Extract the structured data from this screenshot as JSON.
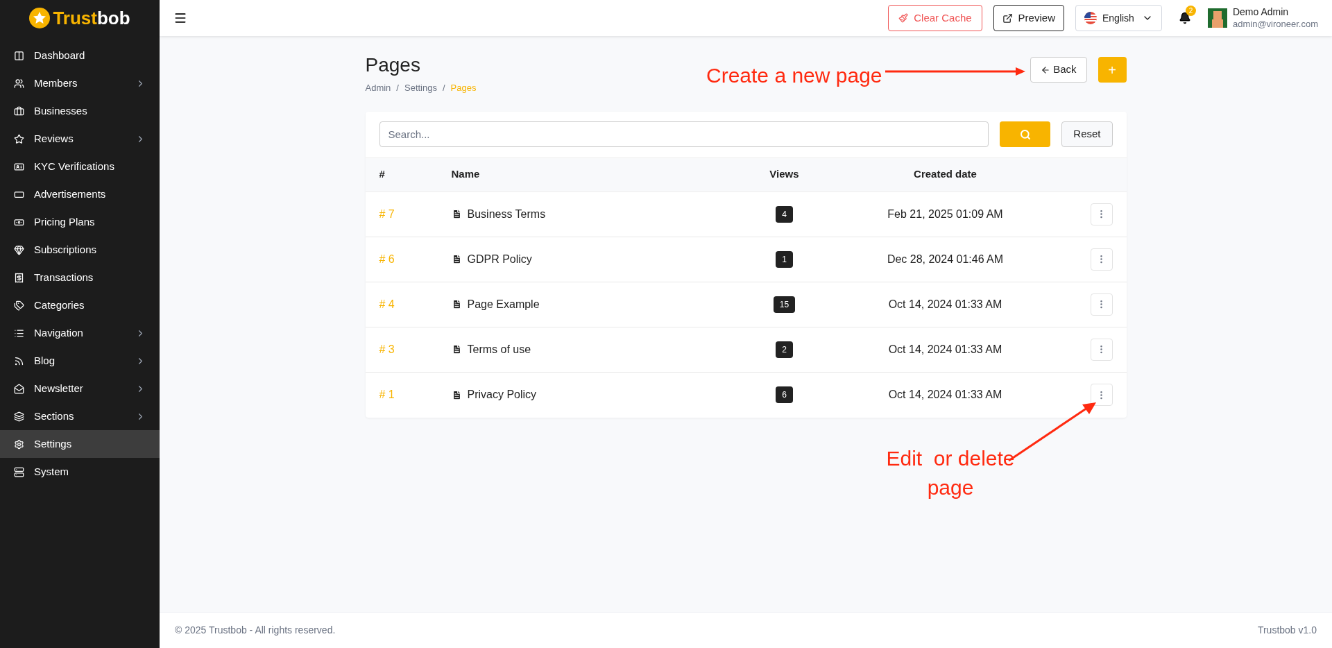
{
  "brand": {
    "name_part1": "Trust",
    "name_part2": "bob"
  },
  "sidebar": {
    "items": [
      {
        "label": "Dashboard",
        "expandable": false,
        "selected": false
      },
      {
        "label": "Members",
        "expandable": true,
        "selected": false
      },
      {
        "label": "Businesses",
        "expandable": false,
        "selected": false
      },
      {
        "label": "Reviews",
        "expandable": true,
        "selected": false
      },
      {
        "label": "KYC Verifications",
        "expandable": false,
        "selected": false
      },
      {
        "label": "Advertisements",
        "expandable": false,
        "selected": false
      },
      {
        "label": "Pricing Plans",
        "expandable": false,
        "selected": false
      },
      {
        "label": "Subscriptions",
        "expandable": false,
        "selected": false
      },
      {
        "label": "Transactions",
        "expandable": false,
        "selected": false
      },
      {
        "label": "Categories",
        "expandable": false,
        "selected": false
      },
      {
        "label": "Navigation",
        "expandable": true,
        "selected": false
      },
      {
        "label": "Blog",
        "expandable": true,
        "selected": false
      },
      {
        "label": "Newsletter",
        "expandable": true,
        "selected": false
      },
      {
        "label": "Sections",
        "expandable": true,
        "selected": false
      },
      {
        "label": "Settings",
        "expandable": false,
        "selected": true
      },
      {
        "label": "System",
        "expandable": false,
        "selected": false
      }
    ]
  },
  "topbar": {
    "clear_cache": "Clear Cache",
    "preview": "Preview",
    "language": "English",
    "notifications": "2",
    "user_name": "Demo Admin",
    "user_email": "admin@vironeer.com"
  },
  "page": {
    "title": "Pages",
    "breadcrumb": [
      "Admin",
      "Settings",
      "Pages"
    ],
    "breadcrumb_separator": "/",
    "back": "Back",
    "add": "+"
  },
  "search": {
    "placeholder": "Search...",
    "reset": "Reset"
  },
  "table": {
    "columns": [
      "#",
      "Name",
      "Views",
      "Created date"
    ],
    "rows": [
      {
        "id": "# 7",
        "name": "Business Terms",
        "views": "4",
        "created": "Feb 21, 2025 01:09 AM"
      },
      {
        "id": "# 6",
        "name": "GDPR Policy",
        "views": "1",
        "created": "Dec 28, 2024 01:46 AM"
      },
      {
        "id": "# 4",
        "name": "Page Example",
        "views": "15",
        "created": "Oct 14, 2024 01:33 AM"
      },
      {
        "id": "# 3",
        "name": "Terms of use",
        "views": "2",
        "created": "Oct 14, 2024 01:33 AM"
      },
      {
        "id": "# 1",
        "name": "Privacy Policy",
        "views": "6",
        "created": "Oct 14, 2024 01:33 AM"
      }
    ]
  },
  "annotations": [
    {
      "text": "Create a new page"
    },
    {
      "text": "Edit  or delete page"
    }
  ],
  "footer": {
    "copyright": "© 2025 Trustbob - All rights reserved.",
    "version": "Trustbob v1.0"
  }
}
